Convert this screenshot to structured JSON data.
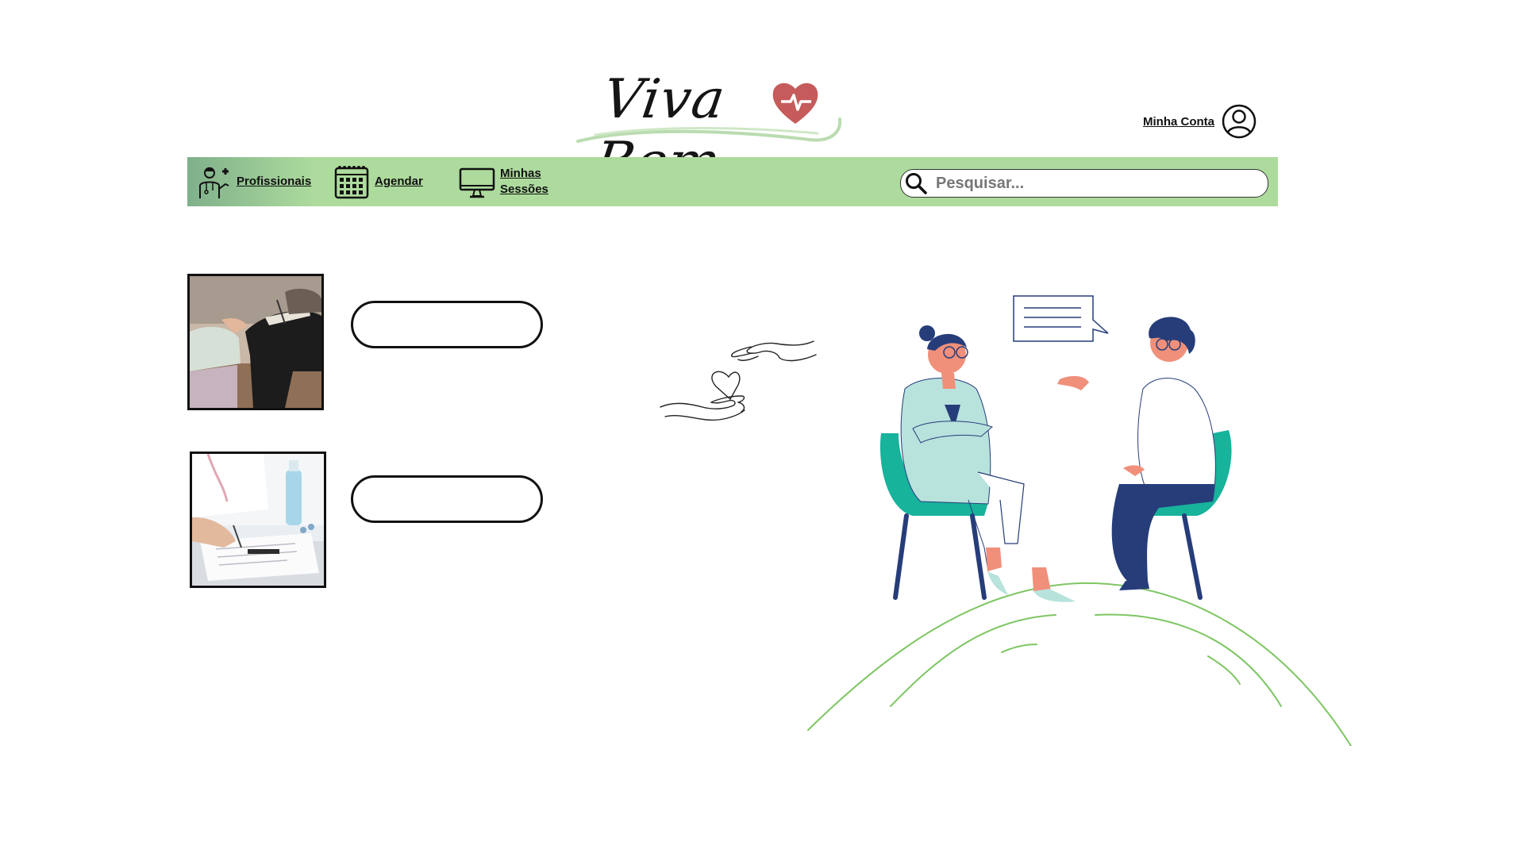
{
  "logo": {
    "text": "Viva Bem"
  },
  "account": {
    "label": "Minha Conta",
    "icon": "user-circle-icon"
  },
  "nav": {
    "items": [
      {
        "label": "Profissionais",
        "icon": "doctor-icon"
      },
      {
        "label": "Agendar",
        "icon": "calendar-icon"
      },
      {
        "label": "Minhas Sessões",
        "icon": "monitor-icon"
      }
    ]
  },
  "search": {
    "placeholder": "Pesquisar...",
    "value": "",
    "icon": "search-icon"
  },
  "options": [
    {
      "image": "therapy-session-photo",
      "button_label": ""
    },
    {
      "image": "doctor-writing-photo",
      "button_label": ""
    }
  ],
  "colors": {
    "navbar": "#addb9d",
    "logo_heart": "#c65b5b",
    "logo_swoosh": "#b9dcb0",
    "teal_chair": "#17b39b",
    "navy": "#263d7a",
    "hill_line": "#7ec663"
  }
}
